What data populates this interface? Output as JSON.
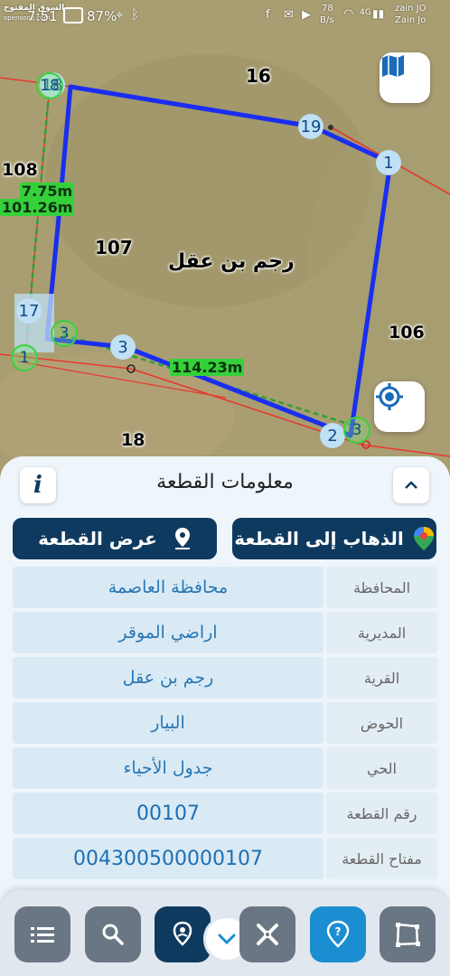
{
  "status_bar": {
    "time": "7:51",
    "battery": "87%",
    "net_speed_value": "78",
    "net_speed_unit": "B/s",
    "carrier_1": "zain JO",
    "carrier_2": "Zain Jo",
    "network_badge": "4G",
    "watermark_line1": "السوق المفتوح",
    "watermark_line2": "opensooq.com"
  },
  "map": {
    "parcel_numbers": {
      "north": "16",
      "west_a": "108",
      "center": "107",
      "east": "106",
      "south": "18"
    },
    "village_label": "رجم بن عقل",
    "measurements": {
      "m1": "7.75m",
      "m2": "101.26m",
      "m3": "114.23m"
    },
    "vertex_labels": {
      "v18": "18",
      "v19": "19",
      "v1": "1",
      "v17": "17",
      "v3": "3",
      "v2": "2"
    },
    "green_markers": {
      "g_top": "18",
      "g_left": "1",
      "g_mid": "3",
      "g_bottom": "3"
    },
    "colors": {
      "parcel_outline": "#1a2ef0",
      "boundary": "#e8382e",
      "measure_line": "#2fa035"
    }
  },
  "panel": {
    "title": "معلومات القطعة",
    "info_icon": "i",
    "go_to_parcel": "الذهاب إلى القطعة",
    "show_parcel": "عرض القطعة",
    "rows": [
      {
        "label": "المحافظة",
        "value": "محافظة العاصمة"
      },
      {
        "label": "المديرية",
        "value": "اراضي الموقر"
      },
      {
        "label": "القرية",
        "value": "رجم بن عقل"
      },
      {
        "label": "الحوض",
        "value": "البيار"
      },
      {
        "label": "الحي",
        "value": "جدول الأحياء"
      },
      {
        "label": "رقم القطعة",
        "value": "00107"
      },
      {
        "label": "مفتاح القطعة",
        "value": "004300500000107"
      }
    ]
  },
  "toolbar": {
    "icons": [
      "list-icon",
      "search-icon",
      "location-pin-icon",
      "chevron-down-icon",
      "measure-tool-icon",
      "help-icon",
      "polygon-icon"
    ]
  }
}
